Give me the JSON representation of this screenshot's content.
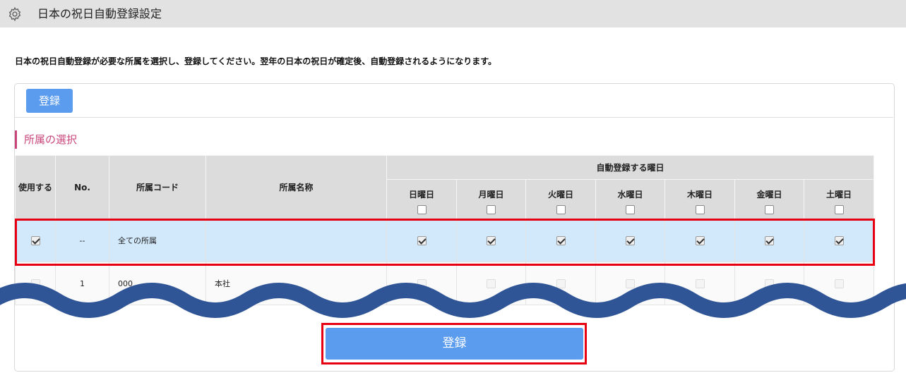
{
  "header": {
    "title": "日本の祝日自動登録設定",
    "icon": "gear-icon"
  },
  "description": "日本の祝日自動登録が必要な所属を選択し、登録してください。翌年の日本の祝日が確定後、自動登録されるようになります。",
  "toolbar": {
    "register_label": "登録"
  },
  "section": {
    "title": "所属の選択"
  },
  "table": {
    "headers": {
      "use": "使用する",
      "no": "No.",
      "code": "所属コード",
      "name": "所属名称",
      "weekday_group": "自動登録する曜日",
      "days": [
        "日曜日",
        "月曜日",
        "火曜日",
        "水曜日",
        "木曜日",
        "金曜日",
        "土曜日"
      ]
    },
    "header_checks": [
      false,
      false,
      false,
      false,
      false,
      false,
      false
    ],
    "rows": [
      {
        "use": true,
        "no": "--",
        "code": "全ての所属",
        "name": "",
        "days": [
          true,
          true,
          true,
          true,
          true,
          true,
          true
        ],
        "highlight": true
      },
      {
        "use": false,
        "no": "1",
        "code": "000",
        "name": "本社",
        "days": [
          false,
          false,
          false,
          false,
          false,
          false,
          false
        ],
        "highlight": false
      }
    ]
  },
  "footer": {
    "register_label": "登録"
  },
  "colors": {
    "accent_button": "#5b9cef",
    "section_accent": "#c8457a",
    "highlight_row": "#d2e8fb",
    "annotation_red": "#e60012",
    "wave_blue": "#2f5597"
  }
}
